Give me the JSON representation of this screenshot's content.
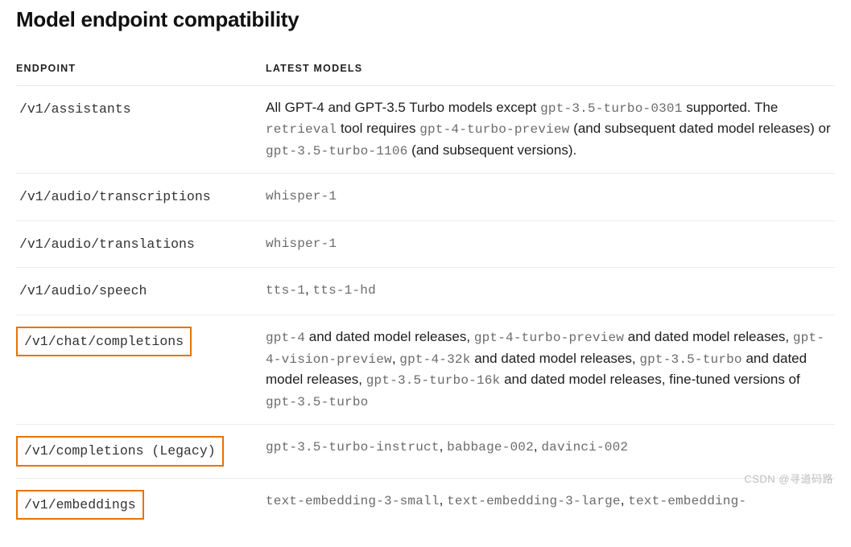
{
  "title": "Model endpoint compatibility",
  "table": {
    "headers": {
      "endpoint": "ENDPOINT",
      "models": "LATEST MODELS"
    },
    "rows": [
      {
        "endpoint": "/v1/assistants",
        "highlighted": false,
        "model_segments": [
          {
            "text": "All GPT-4 and GPT-3.5 Turbo models except ",
            "code": false
          },
          {
            "text": "gpt-3.5-turbo-0301",
            "code": true
          },
          {
            "text": " supported. The ",
            "code": false
          },
          {
            "text": "retrieval",
            "code": true
          },
          {
            "text": " tool requires ",
            "code": false
          },
          {
            "text": "gpt-4-turbo-preview",
            "code": true
          },
          {
            "text": " (and subsequent dated model releases) or ",
            "code": false
          },
          {
            "text": "gpt-3.5-turbo-1106",
            "code": true
          },
          {
            "text": " (and subsequent versions).",
            "code": false
          }
        ]
      },
      {
        "endpoint": "/v1/audio/transcriptions",
        "highlighted": false,
        "model_segments": [
          {
            "text": "whisper-1",
            "code": true
          }
        ]
      },
      {
        "endpoint": "/v1/audio/translations",
        "highlighted": false,
        "model_segments": [
          {
            "text": "whisper-1",
            "code": true
          }
        ]
      },
      {
        "endpoint": "/v1/audio/speech",
        "highlighted": false,
        "model_segments": [
          {
            "text": "tts-1",
            "code": true
          },
          {
            "text": ", ",
            "code": false
          },
          {
            "text": "tts-1-hd",
            "code": true
          }
        ]
      },
      {
        "endpoint": "/v1/chat/completions",
        "highlighted": true,
        "model_segments": [
          {
            "text": "gpt-4",
            "code": true
          },
          {
            "text": " and dated model releases, ",
            "code": false
          },
          {
            "text": "gpt-4-turbo-preview",
            "code": true
          },
          {
            "text": " and dated model releases, ",
            "code": false
          },
          {
            "text": "gpt-4-vision-preview",
            "code": true
          },
          {
            "text": ", ",
            "code": false
          },
          {
            "text": "gpt-4-32k",
            "code": true
          },
          {
            "text": " and dated model releases, ",
            "code": false
          },
          {
            "text": "gpt-3.5-turbo",
            "code": true
          },
          {
            "text": " and dated model releases, ",
            "code": false
          },
          {
            "text": "gpt-3.5-turbo-16k",
            "code": true
          },
          {
            "text": " and dated model releases, fine-tuned versions of ",
            "code": false
          },
          {
            "text": "gpt-3.5-turbo",
            "code": true
          }
        ]
      },
      {
        "endpoint": "/v1/completions (Legacy)",
        "highlighted": true,
        "model_segments": [
          {
            "text": "gpt-3.5-turbo-instruct",
            "code": true
          },
          {
            "text": ", ",
            "code": false
          },
          {
            "text": "babbage-002",
            "code": true
          },
          {
            "text": ", ",
            "code": false
          },
          {
            "text": "davinci-002",
            "code": true
          }
        ]
      },
      {
        "endpoint": "/v1/embeddings",
        "highlighted": true,
        "last": true,
        "model_segments": [
          {
            "text": "text-embedding-3-small",
            "code": true
          },
          {
            "text": ", ",
            "code": false
          },
          {
            "text": "text-embedding-3-large",
            "code": true
          },
          {
            "text": ", ",
            "code": false
          },
          {
            "text": "text-embedding-",
            "code": true
          }
        ]
      }
    ]
  },
  "watermark": "CSDN @寻道码路"
}
